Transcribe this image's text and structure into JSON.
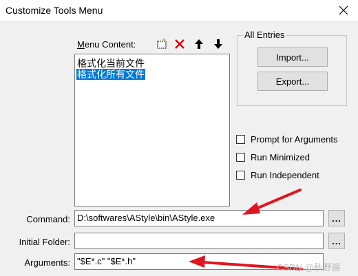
{
  "window": {
    "title": "Customize Tools Menu"
  },
  "menu_content": {
    "label_first": "M",
    "label_rest": "enu Content:",
    "items": [
      {
        "label": "格式化当前文件",
        "selected": false
      },
      {
        "label": "格式化所有文件",
        "selected": true
      }
    ]
  },
  "all_entries": {
    "legend": "All Entries",
    "import_label": "Import...",
    "export_label": "Export..."
  },
  "options": {
    "prompt_label": "Prompt for  Arguments",
    "minimized_label": "Run Minimized",
    "independent_label": "Run Independent"
  },
  "fields": {
    "command_label": "Command:",
    "command_value": "D:\\softwares\\AStyle\\bin\\AStyle.exe",
    "folder_label": "Initial Folder:",
    "folder_value": "",
    "arguments_label": "Arguments:",
    "arguments_value": "\"$E*.c\" \"$E*.h\"",
    "browse_label": "..."
  },
  "watermark": "CSDN @秋野酱",
  "colors": {
    "selection": "#0078d7",
    "arrow": "#e0161e"
  }
}
